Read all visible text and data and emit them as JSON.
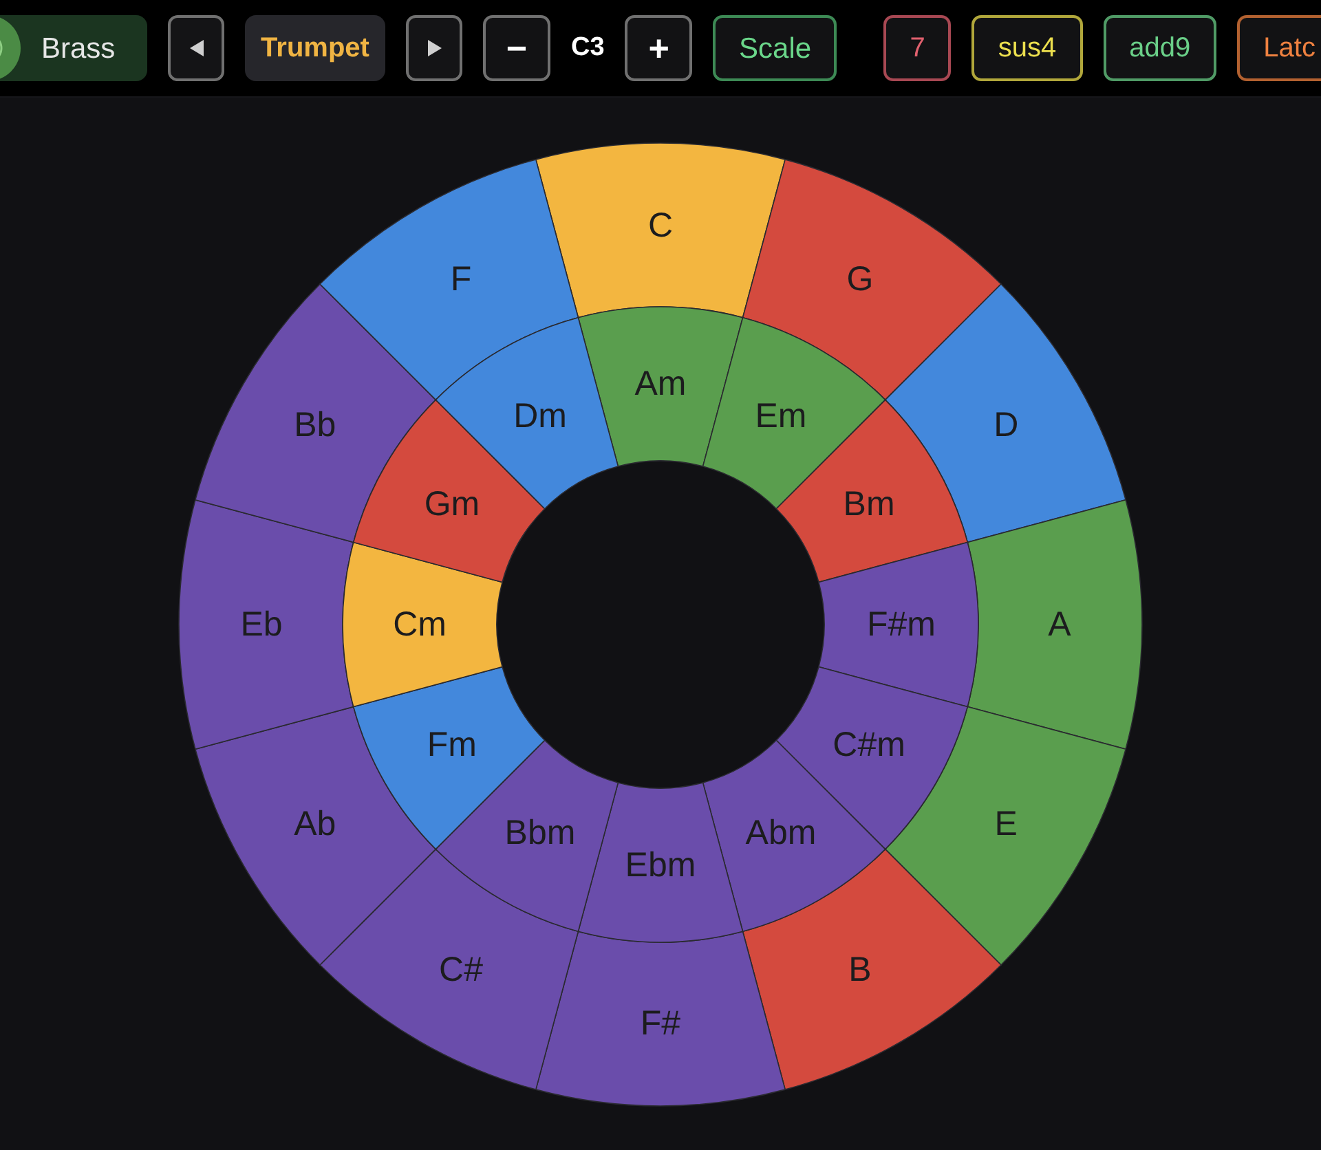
{
  "toolbar": {
    "category_button": {
      "label": "Brass"
    },
    "instrument_button": {
      "label": "Trumpet"
    },
    "octave": {
      "down": "−",
      "label": "C3",
      "up": "+"
    },
    "scale_button": {
      "label": "Scale"
    },
    "toggles": [
      {
        "label": "7",
        "color": "#e0606e"
      },
      {
        "label": "sus4",
        "color": "#ecdf4e"
      },
      {
        "label": "add9",
        "color": "#6acf88"
      },
      {
        "label": "Latc",
        "color": "#ef8140"
      }
    ]
  },
  "wheel": {
    "major": [
      {
        "label": "C",
        "color": "#f3b640"
      },
      {
        "label": "G",
        "color": "#d44a3e"
      },
      {
        "label": "D",
        "color": "#4388dc"
      },
      {
        "label": "A",
        "color": "#5a9e4e"
      },
      {
        "label": "E",
        "color": "#5a9e4e"
      },
      {
        "label": "B",
        "color": "#d44a3e"
      },
      {
        "label": "F#",
        "color": "#6a4dab"
      },
      {
        "label": "C#",
        "color": "#6a4dab"
      },
      {
        "label": "Ab",
        "color": "#6a4dab"
      },
      {
        "label": "Eb",
        "color": "#6a4dab"
      },
      {
        "label": "Bb",
        "color": "#6a4dab"
      },
      {
        "label": "F",
        "color": "#4388dc"
      }
    ],
    "minor": [
      {
        "label": "Am",
        "color": "#5a9e4e"
      },
      {
        "label": "Em",
        "color": "#5a9e4e"
      },
      {
        "label": "Bm",
        "color": "#d44a3e"
      },
      {
        "label": "F#m",
        "color": "#6a4dab"
      },
      {
        "label": "C#m",
        "color": "#6a4dab"
      },
      {
        "label": "Abm",
        "color": "#6a4dab"
      },
      {
        "label": "Ebm",
        "color": "#6a4dab"
      },
      {
        "label": "Bbm",
        "color": "#6a4dab"
      },
      {
        "label": "Fm",
        "color": "#4388dc"
      },
      {
        "label": "Cm",
        "color": "#f3b640"
      },
      {
        "label": "Gm",
        "color": "#d44a3e"
      },
      {
        "label": "Dm",
        "color": "#4388dc"
      }
    ]
  }
}
